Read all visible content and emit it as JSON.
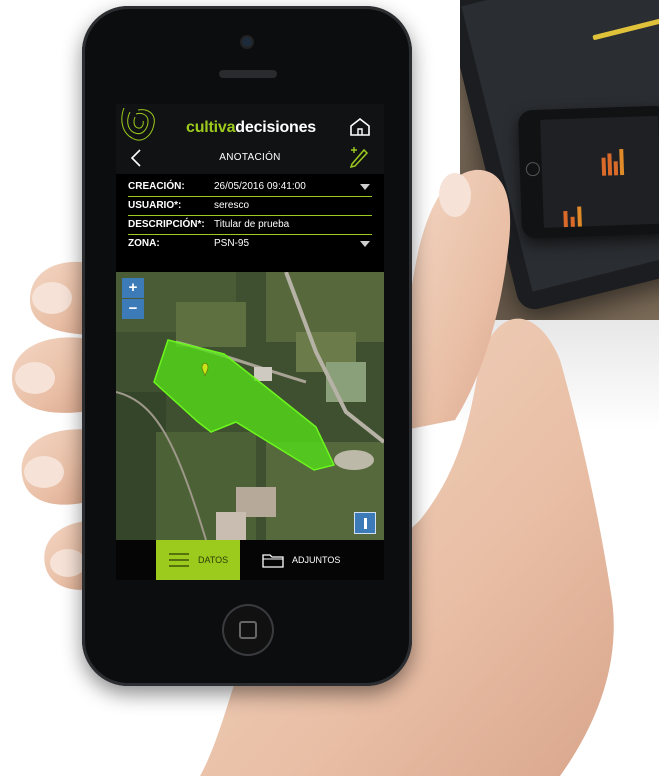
{
  "app": {
    "brand_part1": "cultiva",
    "brand_part2": "decisiones",
    "screen_title": "ANOTACIÓN"
  },
  "form": [
    {
      "label": "CREACIÓN:",
      "value": "26/05/2016  09:41:00",
      "dropdown": true
    },
    {
      "label": "USUARIO*:",
      "value": "seresco",
      "dropdown": false
    },
    {
      "label": "DESCRIPCIÓN*:",
      "value": "Titular de prueba",
      "dropdown": false
    },
    {
      "label": "ZONA:",
      "value": "PSN-95",
      "dropdown": true
    }
  ],
  "map": {
    "zoom_in": "+",
    "zoom_out": "−"
  },
  "footer": {
    "datos_label": "DATOS",
    "adjuntos_label": "ADJUNTOS",
    "active_tab": "DATOS"
  },
  "colors": {
    "accent": "#9ccb1d",
    "map_polygon": "#55e018",
    "map_button": "#3d7ab8"
  }
}
